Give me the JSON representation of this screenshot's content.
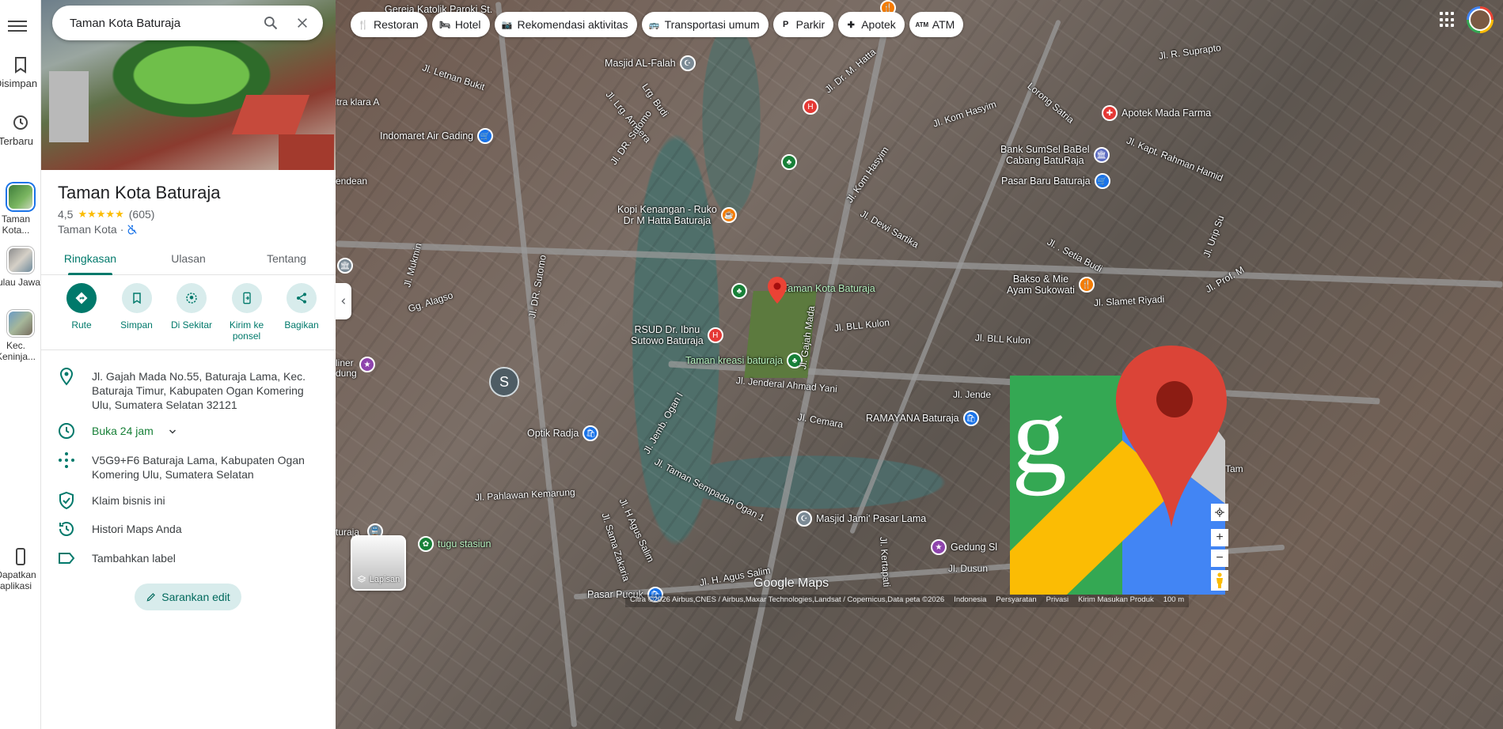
{
  "search": {
    "query": "Taman Kota Baturaja"
  },
  "rail": {
    "items": [
      {
        "label": "Disimpan"
      },
      {
        "label": "Terbaru"
      },
      {
        "label": "Taman Kota..."
      },
      {
        "label": "Pulau Jawa"
      },
      {
        "label": "Kec. Keninja..."
      },
      {
        "label": "Dapatkan aplikasi"
      }
    ]
  },
  "place": {
    "title": "Taman Kota Baturaja",
    "rating": "4,5",
    "stars": "★★★★★",
    "reviews": "(605)",
    "category": "Taman Kota",
    "separator": "·"
  },
  "tabs": [
    {
      "label": "Ringkasan"
    },
    {
      "label": "Ulasan"
    },
    {
      "label": "Tentang"
    }
  ],
  "actions": [
    {
      "label": "Rute"
    },
    {
      "label": "Simpan"
    },
    {
      "label": "Di Sekitar"
    },
    {
      "label": "Kirim ke ponsel"
    },
    {
      "label": "Bagikan"
    }
  ],
  "info": {
    "address": "Jl. Gajah Mada No.55, Baturaja Lama, Kec. Baturaja Timur, Kabupaten Ogan Komering Ulu, Sumatera Selatan 32121",
    "hours": "Buka 24 jam",
    "plus_code": "V5G9+F6 Baturaja Lama, Kabupaten Ogan Komering Ulu, Sumatera Selatan",
    "claim": "Klaim bisnis ini",
    "history": "Histori Maps Anda",
    "label": "Tambahkan label"
  },
  "suggest_edit": "Sarankan edit",
  "chips": [
    {
      "label": "Restoran"
    },
    {
      "label": "Hotel"
    },
    {
      "label": "Rekomendasi aktivitas"
    },
    {
      "label": "Transportasi umum"
    },
    {
      "label": "Parkir"
    },
    {
      "label": "Apotek"
    },
    {
      "label": "ATM"
    }
  ],
  "map": {
    "pois": {
      "gereja": "Gereja Katolik Paroki St.",
      "masjid_falah": "Masjid AL-Falah",
      "indomaret": "Indomaret Air Gading",
      "kopi": [
        "Kopi Kenangan - Ruko",
        "Dr M Hatta Baturaja"
      ],
      "taman": "Taman Kota Baturaja",
      "rsud": [
        "RSUD Dr. Ibnu",
        "Sutowo Baturaja"
      ],
      "taman_kreasi": "Taman kreasi baturaja",
      "optik": "Optik Radja",
      "ramayana": "RAMAYANA Baturaja",
      "masjid_jami": "Masjid Jami' Pasar Lama",
      "tugu": "tugu stasiun",
      "apotek_mada": "Apotek Mada Farma",
      "bank": [
        "Bank SumSel BaBel",
        "Cabang BatuRaja"
      ],
      "pasar_baru": "Pasar Baru Baturaja",
      "bakso": [
        "Bakso & Mie",
        "Ayam Sukowati"
      ],
      "gedung": "Gedung Sl",
      "pasar_pucuk": "Pasar Pucuk"
    },
    "streets": {
      "letnan": "Jl. Letnan Bukit",
      "klara": "litra klara A",
      "endean": "endean",
      "lrg_budi": "Lrg. Budi",
      "ampera": "Jl. Lrg. Ampera",
      "dr_sutomo": "Jl. DR. Sutomo",
      "dr_hatta": "Jl. Dr. M. Hatta",
      "kom_hasyim": "Jl. Kom Hasyim",
      "kom_hasyim2": "Jl. Kom Hasyim",
      "supra": "Jl. R. Suprapto",
      "lorong_satria": "Lorong Satria",
      "kapt_rahman": "Jl. Kapt. Rahman Hamid",
      "dewi_sartika": "Jl. Dewi Sartika",
      "setia_budi": "Jl. . Setia Budi",
      "mukmin": "Jl. Mukmin",
      "alagso": "Gg. Alagso",
      "gajah_mada": "Jl. Gajah Mada",
      "bll_kulon": "Jl. BLL Kulon",
      "bll_kulon2": "Jl. BLL Kulon",
      "slamet": "Jl. Slamet Riyadi",
      "ahmad_yani": "Jl. Jenderal Ahmad Yani",
      "jende": "Jl. Jende",
      "cemara": "Jl. Cemara",
      "jemb_ogan": "Jl. Jemb. Ogan I",
      "taman_sempadan": "Jl. Taman Sempadan Ogan 1",
      "pahlawan": "Jl. Pahlawan Kemarung",
      "h_agus": "Jl. H Agus Salim",
      "h_agus2": "Jl. H. Agus Salim",
      "sama_zakaria": "Jl. Sama Zakaria",
      "kertapati": "Jl. Kertapati",
      "dusun": "Jl. Dusun",
      "liner": "liner",
      "dung": "dung",
      "turaja": "turaja",
      "tam": "Tam",
      "urip": "Jl. Urip Su",
      "prof": "Jl. Prof. M"
    },
    "streetview_letter": "S",
    "layers_label": "Lapisan",
    "watermark": "Google Maps"
  },
  "footer": [
    "Citra ©2026 Airbus,CNES / Airbus,Maxar Technologies,Landsat / Copernicus,Data peta ©2026",
    "Indonesia",
    "Persyaratan",
    "Privasi",
    "Kirim Masukan Produk",
    "100 m"
  ],
  "colors": {
    "accent": "#00796b",
    "star": "#fbbc04",
    "pin_red": "#ea4335"
  }
}
